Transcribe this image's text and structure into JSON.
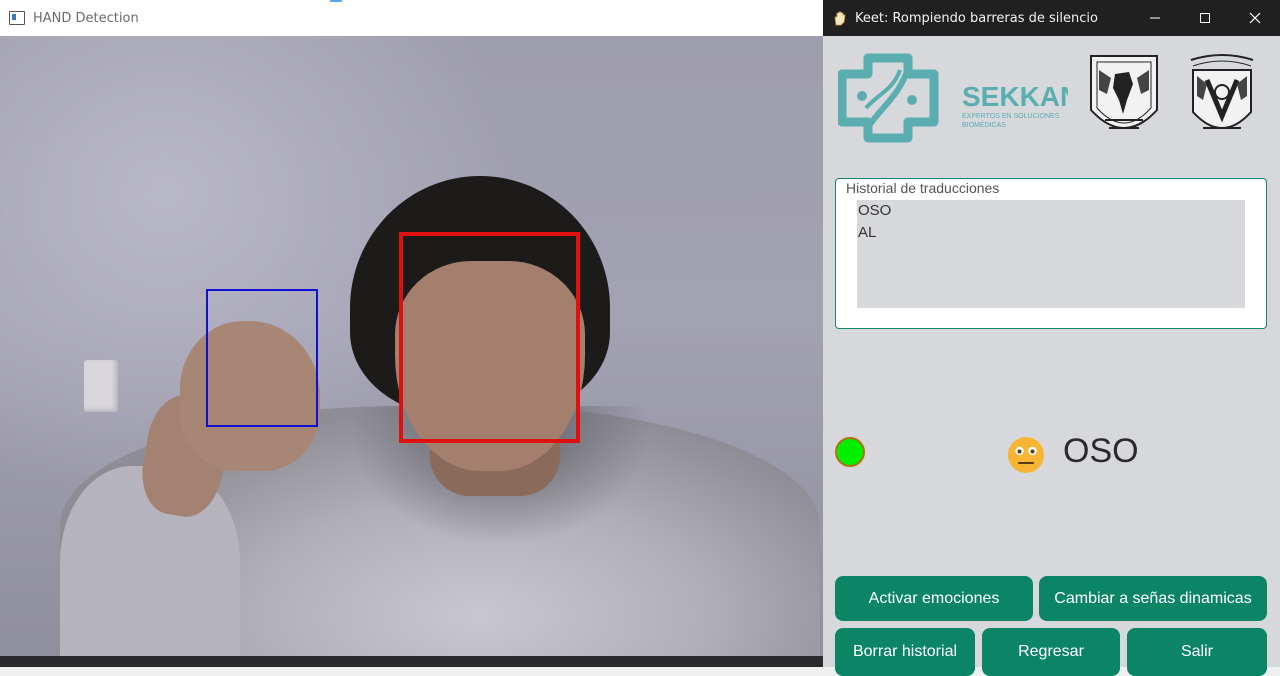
{
  "camera_window": {
    "title": "HAND Detection"
  },
  "control_window": {
    "title": "Keet: Rompiendo barreras de silencio",
    "controls": {
      "minimize": "—",
      "maximize": "☐",
      "close": "✕"
    }
  },
  "logos": {
    "sekkan_name": "SEKKAN",
    "sekkan_tagline_1": "EXPERTOS EN SOLUCIONES",
    "sekkan_tagline_2": "BIOMÉDICAS"
  },
  "history": {
    "title": "Historial de traducciones",
    "items": [
      "OSO",
      "AL"
    ]
  },
  "status": {
    "indicator_color": "#00f000",
    "emotion_icon": "neutral-face-emoji",
    "current_translation": "OSO"
  },
  "buttons": {
    "activate_emotions": "Activar emociones",
    "switch_dynamic": "Cambiar a señas dinamicas",
    "clear_history": "Borrar historial",
    "back": "Regresar",
    "exit": "Salir"
  },
  "colors": {
    "accent": "#0c8567",
    "hand_box": "#1010d0",
    "face_box": "#e01010"
  }
}
